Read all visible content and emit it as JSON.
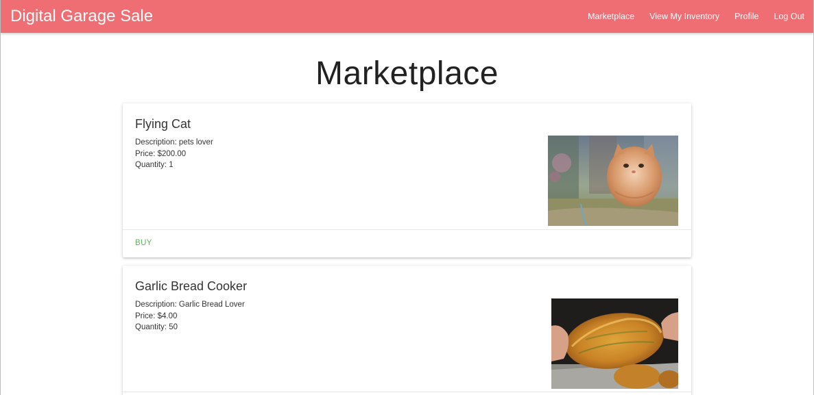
{
  "app": {
    "brand": "Digital Garage Sale",
    "accent_color": "#ef6e73"
  },
  "nav": {
    "items": [
      {
        "label": "Marketplace"
      },
      {
        "label": "View My Inventory"
      },
      {
        "label": "Profile"
      },
      {
        "label": "Log Out"
      }
    ]
  },
  "page": {
    "title": "Marketplace"
  },
  "listings": [
    {
      "title": "Flying Cat",
      "description": "Description: pets lover",
      "price": "Price: $200.00",
      "quantity": "Quantity: 1",
      "action_label": "BUY",
      "image": "flying-cat-photo"
    },
    {
      "title": "Garlic Bread Cooker",
      "description": "Description: Garlic Bread Lover",
      "price": "Price: $4.00",
      "quantity": "Quantity: 50",
      "image": "garlic-bread-photo"
    }
  ]
}
